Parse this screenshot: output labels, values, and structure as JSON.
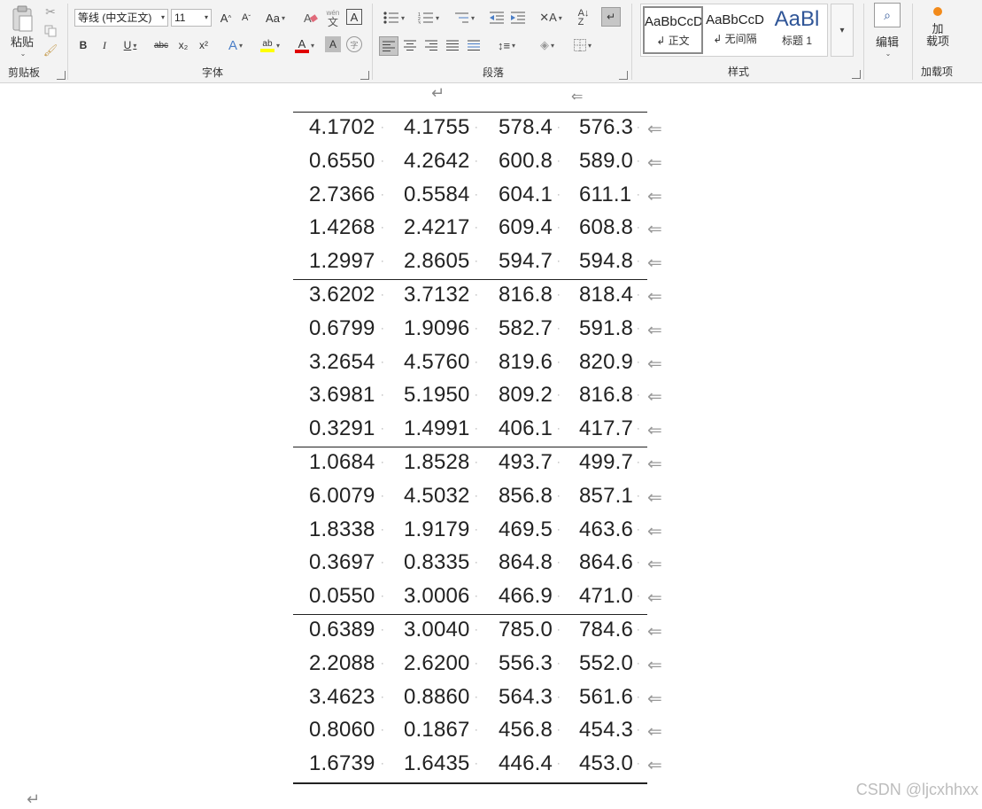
{
  "ribbon": {
    "clipboard": {
      "group_label": "剪贴板",
      "paste_label": "粘贴"
    },
    "font": {
      "group_label": "字体",
      "font_name": "等线 (中文正文)",
      "font_size": "11",
      "grow": "A",
      "shrink": "A",
      "change_case": "Aa",
      "bold": "B",
      "italic": "I",
      "underline": "U",
      "strike": "abc",
      "subscript": "x₂",
      "superscript": "x²",
      "text_effect": "A",
      "highlight": "ab",
      "font_color": "A",
      "char_shade": "A",
      "enclose": "字",
      "phonetic": "wén",
      "char_border": "A"
    },
    "paragraph": {
      "group_label": "段落"
    },
    "styles": {
      "group_label": "样式",
      "items": [
        {
          "sample": "AaBbCcD",
          "name": "↲ 正文"
        },
        {
          "sample": "AaBbCcD",
          "name": "↲ 无间隔"
        },
        {
          "sample": "AaBl",
          "name": "标题 1"
        }
      ]
    },
    "editing": {
      "label": "编辑"
    },
    "addins": {
      "label": "加\n载项",
      "group_label": "加载项"
    }
  },
  "document": {
    "rows": [
      [
        "4.1702",
        "4.1755",
        "578.4",
        "576.3"
      ],
      [
        "0.6550",
        "4.2642",
        "600.8",
        "589.0"
      ],
      [
        "2.7366",
        "0.5584",
        "604.1",
        "611.1"
      ],
      [
        "1.4268",
        "2.4217",
        "609.4",
        "608.8"
      ],
      [
        "1.2997",
        "2.8605",
        "594.7",
        "594.8"
      ],
      [
        "3.6202",
        "3.7132",
        "816.8",
        "818.4"
      ],
      [
        "0.6799",
        "1.9096",
        "582.7",
        "591.8"
      ],
      [
        "3.2654",
        "4.5760",
        "819.6",
        "820.9"
      ],
      [
        "3.6981",
        "5.1950",
        "809.2",
        "816.8"
      ],
      [
        "0.3291",
        "1.4991",
        "406.1",
        "417.7"
      ],
      [
        "1.0684",
        "1.8528",
        "493.7",
        "499.7"
      ],
      [
        "6.0079",
        "4.5032",
        "856.8",
        "857.1"
      ],
      [
        "1.8338",
        "1.9179",
        "469.5",
        "463.6"
      ],
      [
        "0.3697",
        "0.8335",
        "864.8",
        "864.6"
      ],
      [
        "0.0550",
        "3.0006",
        "466.9",
        "471.0"
      ],
      [
        "0.6389",
        "3.0040",
        "785.0",
        "784.6"
      ],
      [
        "2.2088",
        "2.6200",
        "556.3",
        "552.0"
      ],
      [
        "3.4623",
        "0.8860",
        "564.3",
        "561.6"
      ],
      [
        "0.8060",
        "0.1867",
        "456.8",
        "454.3"
      ],
      [
        "1.6739",
        "1.6435",
        "446.4",
        "453.0"
      ]
    ],
    "watermark": "CSDN @ljcxhhxx"
  }
}
